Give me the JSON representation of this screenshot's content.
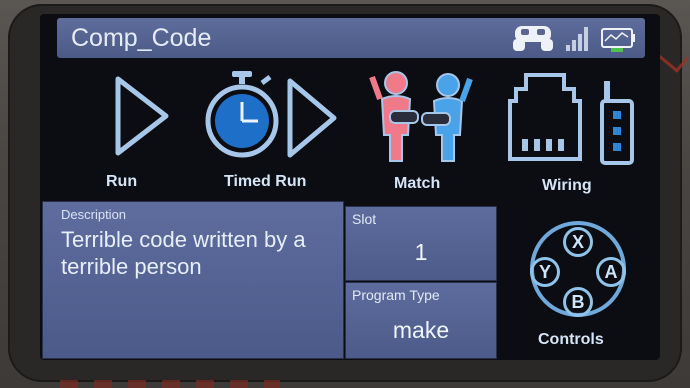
{
  "window": {
    "title": "Comp_Code"
  },
  "toolbar": {
    "run_label": "Run",
    "timed_run_label": "Timed Run",
    "match_label": "Match",
    "wiring_label": "Wiring",
    "controls_label": "Controls"
  },
  "description": {
    "label": "Description",
    "text": "Terrible code written by a terrible person"
  },
  "slot": {
    "label": "Slot",
    "value": "1"
  },
  "program_type": {
    "label": "Program Type",
    "value": "make"
  },
  "controller_buttons": {
    "x": "X",
    "y": "Y",
    "a": "A",
    "b": "B"
  },
  "colors": {
    "title_bar": "#5e6d9c",
    "panel": "#5d6c9d",
    "icon_stroke": "#a7c7ea",
    "player_red": "#f07a8a",
    "player_blue": "#4aa3e8",
    "battery_green": "#4ec24a"
  },
  "icons": [
    "controller-icon",
    "signal-icon",
    "battery-icon",
    "play-icon",
    "stopwatch-icon",
    "match-icon",
    "wiring-port-icon",
    "radio-icon",
    "gamepad-buttons-icon"
  ]
}
